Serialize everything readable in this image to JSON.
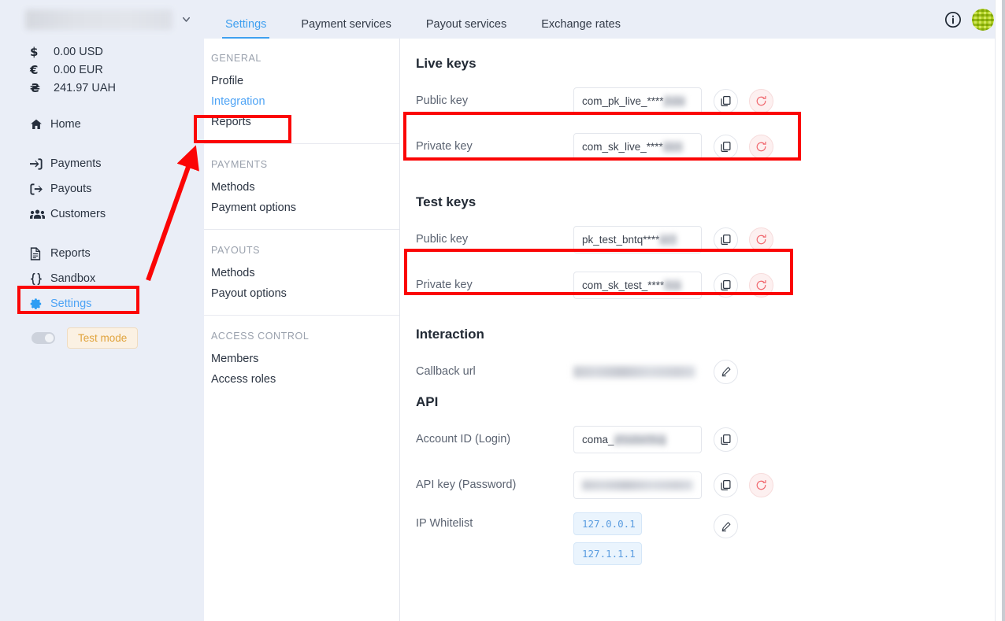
{
  "sidebar": {
    "account_name_hidden": "",
    "balances": [
      {
        "symbol": "$",
        "amount": "0.00 USD"
      },
      {
        "symbol": "€",
        "amount": "0.00 EUR"
      },
      {
        "symbol": "₴",
        "amount": "241.97 UAH"
      }
    ],
    "nav": [
      {
        "label": "Home",
        "icon": "home-icon"
      },
      {
        "label": "Payments",
        "icon": "sign-in-arrow-icon"
      },
      {
        "label": "Payouts",
        "icon": "sign-out-arrow-icon"
      },
      {
        "label": "Customers",
        "icon": "users-icon"
      },
      {
        "label": "Reports",
        "icon": "document-icon"
      },
      {
        "label": "Sandbox",
        "icon": "braces-icon"
      },
      {
        "label": "Settings",
        "icon": "gear-icon"
      }
    ],
    "test_mode_label": "Test mode",
    "test_mode_on": false
  },
  "topbar": {
    "tabs": [
      {
        "label": "Settings",
        "active": true
      },
      {
        "label": "Payment services",
        "active": false
      },
      {
        "label": "Payout services",
        "active": false
      },
      {
        "label": "Exchange rates",
        "active": false
      }
    ],
    "info_icon": "info-circle-icon",
    "avatar_icon": "identicon-avatar"
  },
  "subnav": [
    {
      "title": "GENERAL",
      "items": [
        {
          "label": "Profile",
          "active": false
        },
        {
          "label": "Integration",
          "active": true
        },
        {
          "label": "Reports",
          "active": false
        }
      ]
    },
    {
      "title": "PAYMENTS",
      "items": [
        {
          "label": "Methods",
          "active": false
        },
        {
          "label": "Payment options",
          "active": false
        }
      ]
    },
    {
      "title": "PAYOUTS",
      "items": [
        {
          "label": "Methods",
          "active": false
        },
        {
          "label": "Payout options",
          "active": false
        }
      ]
    },
    {
      "title": "ACCESS CONTROL",
      "items": [
        {
          "label": "Members",
          "active": false
        },
        {
          "label": "Access roles",
          "active": false
        }
      ]
    }
  ],
  "content": {
    "live_keys": {
      "heading": "Live keys",
      "public_label": "Public key",
      "public_value": "com_pk_live_****",
      "private_label": "Private key",
      "private_value": "com_sk_live_****"
    },
    "test_keys": {
      "heading": "Test keys",
      "public_label": "Public key",
      "public_value": "pk_test_bntq****",
      "private_label": "Private key",
      "private_value": "com_sk_test_****"
    },
    "interaction": {
      "heading": "Interaction",
      "callback_label": "Callback url",
      "callback_value": ""
    },
    "api": {
      "heading": "API",
      "account_id_label": "Account ID (Login)",
      "account_id_value": "coma_",
      "api_key_label": "API key (Password)",
      "api_key_value": "",
      "ip_whitelist_label": "IP Whitelist",
      "ip_whitelist": [
        "127.0.0.1",
        "127.1.1.1"
      ]
    },
    "icons": {
      "copy": "copy-icon",
      "refresh": "refresh-icon",
      "edit": "pencil-icon"
    }
  },
  "annotations": {
    "color": "#fb0505",
    "boxes": [
      "settings-nav",
      "integration-nav",
      "live-public-key-row",
      "test-public-key-row"
    ],
    "arrow": "points from Settings nav item to Integration sub-nav item"
  }
}
